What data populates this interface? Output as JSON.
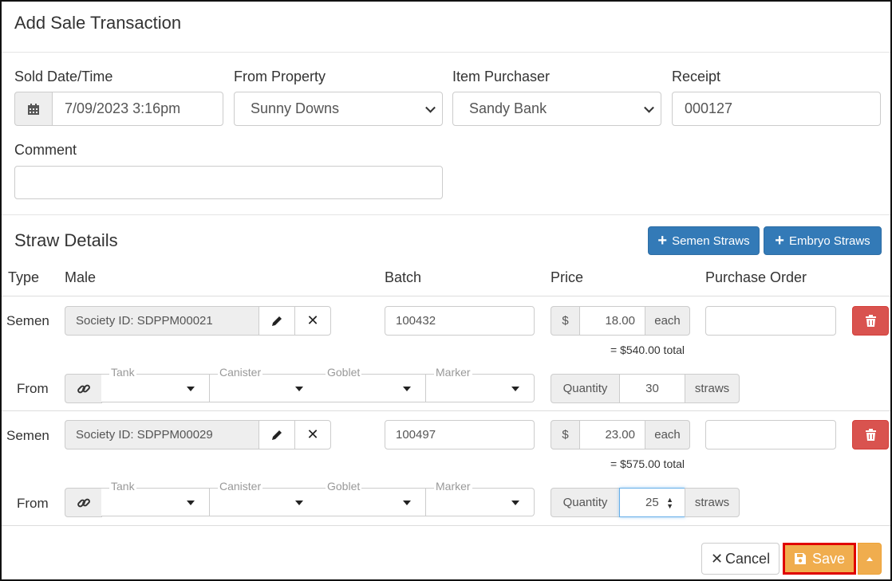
{
  "modal": {
    "title": "Add Sale Transaction"
  },
  "form": {
    "sold_label": "Sold Date/Time",
    "sold_value": "7/09/2023 3:16pm",
    "from_property_label": "From Property",
    "from_property_value": "Sunny Downs",
    "purchaser_label": "Item Purchaser",
    "purchaser_value": "Sandy Bank",
    "receipt_label": "Receipt",
    "receipt_value": "000127",
    "comment_label": "Comment",
    "comment_value": ""
  },
  "straws": {
    "title": "Straw Details",
    "add_semen_label": "Semen Straws",
    "add_embryo_label": "Embryo Straws",
    "headers": {
      "type": "Type",
      "male": "Male",
      "batch": "Batch",
      "price": "Price",
      "po": "Purchase Order"
    },
    "from_label": "From",
    "currency": "$",
    "each_label": "each",
    "quantity_label": "Quantity",
    "straws_unit": "straws",
    "source_legends": {
      "tank": "Tank",
      "canister": "Canister",
      "goblet": "Goblet",
      "marker": "Marker"
    },
    "rows": [
      {
        "type": "Semen",
        "male": "Society ID: SDPPM00021",
        "batch": "100432",
        "price": "18.00",
        "total": "= $540.00 total",
        "quantity": "30",
        "po": ""
      },
      {
        "type": "Semen",
        "male": "Society ID: SDPPM00029",
        "batch": "100497",
        "price": "23.00",
        "total": "= $575.00 total",
        "quantity": "25",
        "po": ""
      }
    ]
  },
  "footer": {
    "cancel_label": "Cancel",
    "save_label": "Save"
  },
  "colors": {
    "primary": "#337ab7",
    "danger": "#d9534f",
    "warning": "#f0ad4e",
    "highlight": "#e00000"
  }
}
